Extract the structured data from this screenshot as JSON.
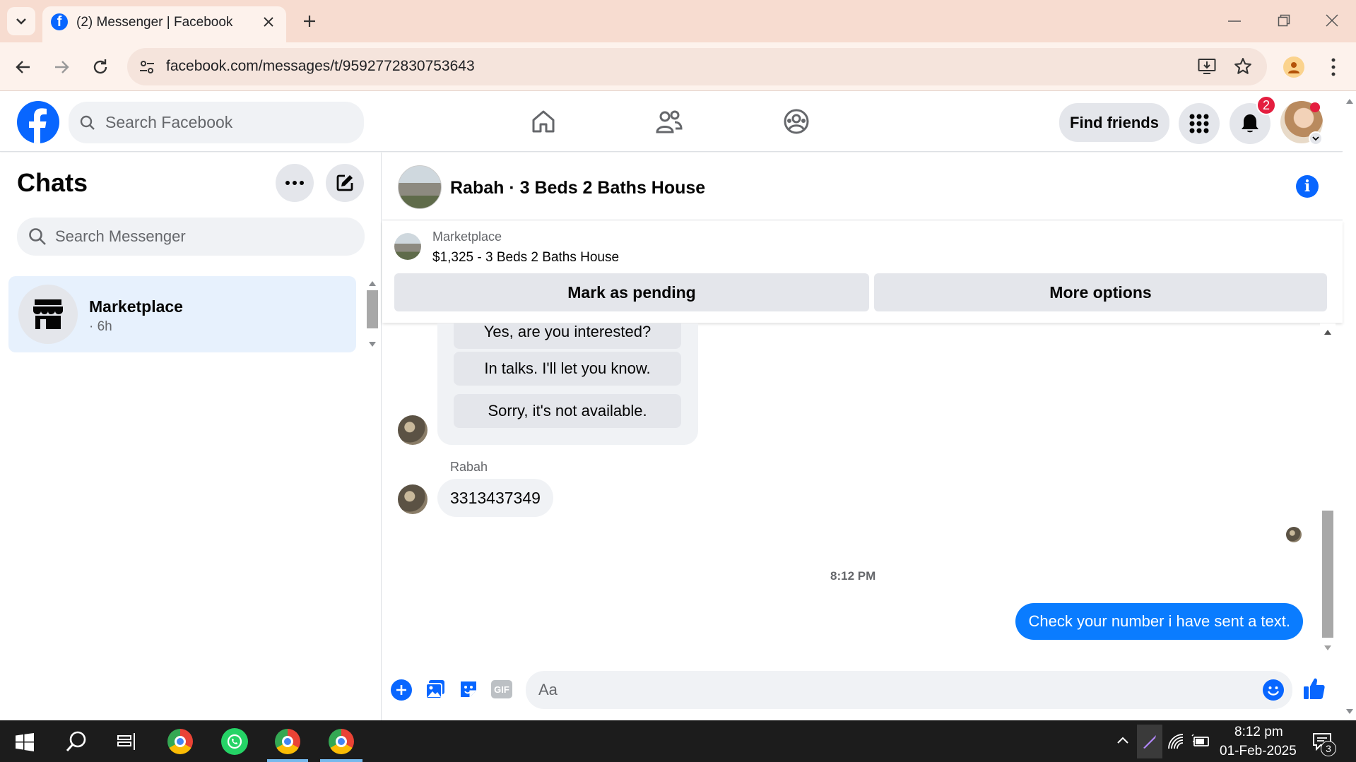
{
  "browser": {
    "tab_title": "(2) Messenger | Facebook",
    "url": "facebook.com/messages/t/9592772830753643"
  },
  "header": {
    "search_placeholder": "Search Facebook",
    "find_friends": "Find friends",
    "notification_count": "2"
  },
  "sidebar": {
    "title": "Chats",
    "search_placeholder": "Search Messenger",
    "chats": [
      {
        "name": "Marketplace",
        "time": "· 6h"
      }
    ]
  },
  "conversation": {
    "title": "Rabah · 3 Beds 2 Baths House",
    "listing": {
      "source": "Marketplace",
      "title": "$1,325 - 3 Beds 2 Baths House",
      "mark_pending": "Mark as pending",
      "more_options": "More options"
    },
    "quick_replies": [
      "Yes, are you interested?",
      "In talks. I'll let you know.",
      "Sorry, it's not available."
    ],
    "sender_name": "Rabah",
    "received_message": "3313437349",
    "timestamp": "8:12 PM",
    "sent_message": "Check your number i have sent a text.",
    "composer_placeholder": "Aa"
  },
  "taskbar": {
    "time": "8:12 pm",
    "date": "01-Feb-2025",
    "notification_count": "3"
  },
  "colors": {
    "facebook_blue": "#0866ff",
    "messenger_blue": "#0a7cff",
    "badge_red": "#e41e3f",
    "tab_strip": "#f7dcd0"
  }
}
